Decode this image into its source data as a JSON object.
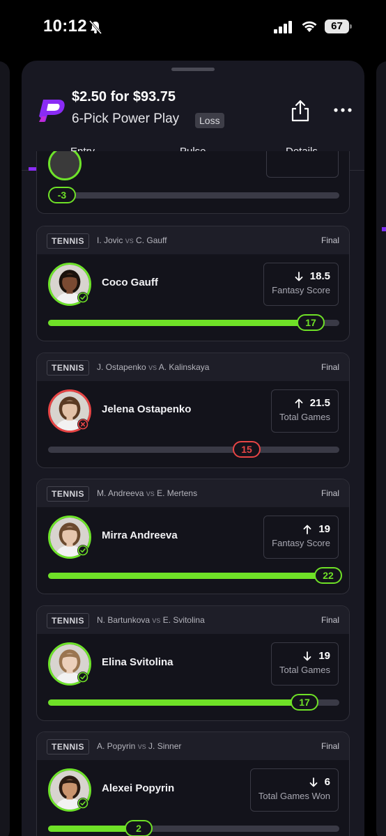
{
  "status_bar": {
    "time": "10:12",
    "battery": "67"
  },
  "header": {
    "title": "$2.50 for $93.75",
    "subtitle": "6-Pick Power Play",
    "badge": "Loss"
  },
  "tabs": [
    {
      "label": "Entry",
      "active": true
    },
    {
      "label": "Pulse",
      "active": false
    },
    {
      "label": "Details",
      "active": false
    }
  ],
  "partial_card": {
    "result": "-3",
    "progress_fraction": 0.07
  },
  "picks": [
    {
      "sport": "TENNIS",
      "team1": "I. Jovic",
      "vs": "vs",
      "team2": "C. Gauff",
      "status": "Final",
      "player": "Coco Gauff",
      "direction": "down",
      "line": "18.5",
      "stat": "Fantasy Score",
      "result": "17",
      "outcome": "win",
      "progress_fraction": 0.92,
      "skin": "#7a4a32",
      "hair": "#1a120c"
    },
    {
      "sport": "TENNIS",
      "team1": "J. Ostapenko",
      "vs": "vs",
      "team2": "A. Kalinskaya",
      "status": "Final",
      "player": "Jelena Ostapenko",
      "direction": "up",
      "line": "21.5",
      "stat": "Total Games",
      "result": "15",
      "outcome": "loss",
      "progress_fraction": 0.7,
      "skin": "#e3c2a8",
      "hair": "#5a3a22"
    },
    {
      "sport": "TENNIS",
      "team1": "M. Andreeva",
      "vs": "vs",
      "team2": "E. Mertens",
      "status": "Final",
      "player": "Mirra Andreeva",
      "direction": "up",
      "line": "19",
      "stat": "Fantasy Score",
      "result": "22",
      "outcome": "win",
      "progress_fraction": 1.0,
      "skin": "#e6c6ad",
      "hair": "#6b4a2e"
    },
    {
      "sport": "TENNIS",
      "team1": "N. Bartunkova",
      "vs": "vs",
      "team2": "E. Svitolina",
      "status": "Final",
      "player": "Elina Svitolina",
      "direction": "down",
      "line": "19",
      "stat": "Total Games",
      "result": "17",
      "outcome": "win",
      "progress_fraction": 0.9,
      "skin": "#ecd0bb",
      "hair": "#9a7550"
    },
    {
      "sport": "TENNIS",
      "team1": "A. Popyrin",
      "vs": "vs",
      "team2": "J. Sinner",
      "status": "Final",
      "player": "Alexei Popyrin",
      "direction": "down",
      "line": "6",
      "stat": "Total Games Won",
      "result": "2",
      "outcome": "win",
      "progress_fraction": 0.33,
      "skin": "#c9946e",
      "hair": "#2b1b12"
    }
  ],
  "colors": {
    "accent": "#8a2bf5",
    "win": "#6fe127",
    "loss": "#e84545",
    "card_bg": "#13131b"
  }
}
